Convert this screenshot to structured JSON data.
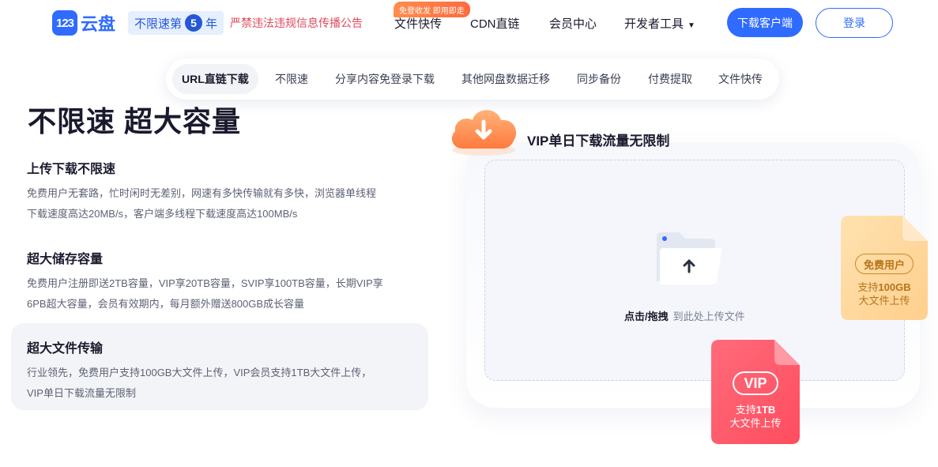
{
  "header": {
    "logo_badge": "123",
    "logo_text": "云盘",
    "speed_pill": {
      "prefix": "不限速第",
      "number": "5",
      "suffix": "年"
    },
    "notice": "严禁违法违规信息传播公告",
    "nav": {
      "file_transfer": "文件快传",
      "file_transfer_tag": "免登收发 即用即走",
      "cdn": "CDN直链",
      "member": "会员中心",
      "developer": "开发者工具",
      "developer_caret": "▼"
    },
    "download_button": "下载客户端",
    "login_button": "登录"
  },
  "tabs": [
    {
      "label": "URL直链下载",
      "active": true
    },
    {
      "label": "不限速",
      "active": false
    },
    {
      "label": "分享内容免登录下载",
      "active": false
    },
    {
      "label": "其他网盘数据迁移",
      "active": false
    },
    {
      "label": "同步备份",
      "active": false
    },
    {
      "label": "付费提取",
      "active": false
    },
    {
      "label": "文件快传",
      "active": false
    }
  ],
  "main": {
    "headline": "不限速 超大容量",
    "features": [
      {
        "title": "上传下载不限速",
        "desc_line1": "免费用户无套路，忙时闲时无差别，网速有多快传输就有多快，浏览器单线程",
        "desc_line2": "下载速度高达20MB/s，客户端多线程下载速度高达100MB/s"
      },
      {
        "title": "超大储存容量",
        "desc_line1": "免费用户注册即送2TB容量，VIP享20TB容量，SVIP享100TB容量，长期VIP享",
        "desc_line2": "6PB超大容量，会员有效期内，每月额外赠送800GB成长容量"
      },
      {
        "title": "超大文件传输",
        "desc_line1": "行业领先，免费用户支持100GB大文件上传，VIP会员支持1TB大文件上传，",
        "desc_line2": "VIP单日下载流量无限制"
      }
    ]
  },
  "illustration": {
    "title": "VIP单日下载流量无限制",
    "upload_action": "点击/拖拽",
    "upload_hint": "到此处上传文件",
    "free_card": {
      "badge": "免费用户",
      "line1_prefix": "支持",
      "line1_bold": "100GB",
      "line2": "大文件上传"
    },
    "vip_card": {
      "badge": "VIP",
      "line1_prefix": "支持",
      "line1_bold": "1TB",
      "line2": "大文件上传"
    }
  },
  "colors": {
    "brand": "#2f6bff",
    "notice_red": "#e04a5b",
    "tag_orange": "#ff7a45",
    "free_gold": "#b5741c",
    "vip_red": "#ff5a68"
  }
}
